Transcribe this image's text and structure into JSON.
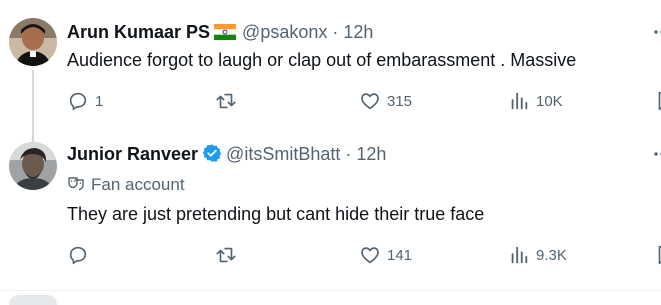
{
  "tweets": [
    {
      "name": "Arun Kumaar PS",
      "handle": "@psakonx",
      "separator": "·",
      "time": "12h",
      "text": "Audience forgot to laugh or clap out of embarassment .  Massive",
      "replies": "1",
      "retweets": "",
      "likes": "315",
      "views": "10K",
      "badge": "india-flag"
    },
    {
      "name": "Junior Ranveer",
      "handle": "@itsSmitBhatt",
      "separator": "·",
      "time": "12h",
      "label": "Fan account",
      "text": "They are just pretending but cant hide their true face",
      "replies": "",
      "retweets": "",
      "likes": "141",
      "views": "9.3K",
      "badge": "verified-check"
    }
  ],
  "colors": {
    "text": "#0f1419",
    "secondary": "#536471",
    "verified": "#1d9bf0",
    "divider": "#eff3f4"
  }
}
